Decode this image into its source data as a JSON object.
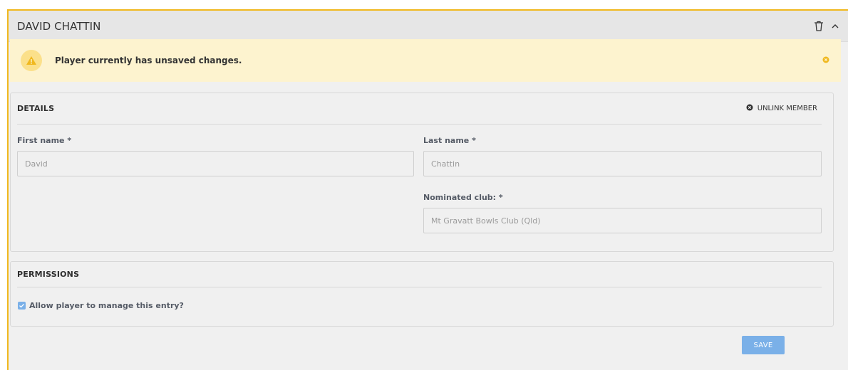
{
  "panel": {
    "title": "DAVID CHATTIN",
    "icons": [
      "trash-icon",
      "chevron-up-icon"
    ]
  },
  "alert": {
    "message": "Player currently has unsaved changes.",
    "icon": "warning-icon",
    "close_icon": "close-circle-icon"
  },
  "details": {
    "heading": "DETAILS",
    "unlink_label": "UNLINK MEMBER",
    "first_name": {
      "label": "First name *",
      "value": "David"
    },
    "last_name": {
      "label": "Last name *",
      "value": "Chattin"
    },
    "club": {
      "label": "Nominated club: *",
      "value": "Mt Gravatt Bowls Club (Qld)"
    }
  },
  "permissions": {
    "heading": "PERMISSIONS",
    "allow_label": "Allow player to manage this entry?",
    "allow_checked": true
  },
  "actions": {
    "save_label": "SAVE"
  },
  "colors": {
    "accent_border": "#f0b81e",
    "alert_bg": "#fdf3cf",
    "primary_button": "#7ab0e8"
  }
}
